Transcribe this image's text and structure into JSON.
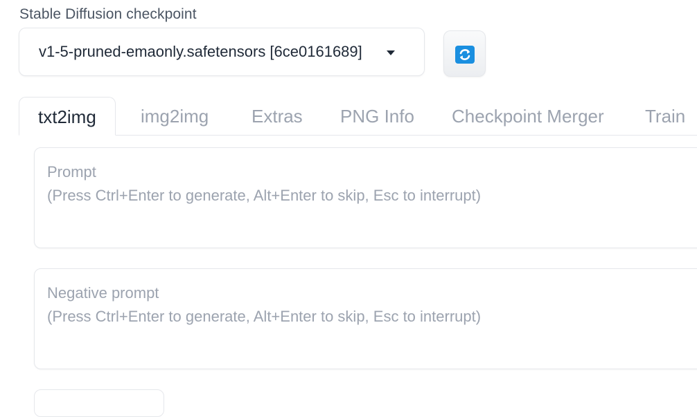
{
  "checkpoint": {
    "label": "Stable Diffusion checkpoint",
    "selected_value": "v1-5-pruned-emaonly.safetensors [6ce0161689]",
    "refresh_icon": "refresh-icon",
    "accent_color": "#1a8fe0"
  },
  "tabs": [
    {
      "label": "txt2img",
      "active": true
    },
    {
      "label": "img2img",
      "active": false
    },
    {
      "label": "Extras",
      "active": false
    },
    {
      "label": "PNG Info",
      "active": false
    },
    {
      "label": "Checkpoint Merger",
      "active": false
    },
    {
      "label": "Train",
      "active": false
    }
  ],
  "prompt": {
    "placeholder_line1": "Prompt",
    "placeholder_line2": "(Press Ctrl+Enter to generate, Alt+Enter to skip, Esc to interrupt)"
  },
  "negative_prompt": {
    "placeholder_line1": "Negative prompt",
    "placeholder_line2": "(Press Ctrl+Enter to generate, Alt+Enter to skip, Esc to interrupt)"
  }
}
